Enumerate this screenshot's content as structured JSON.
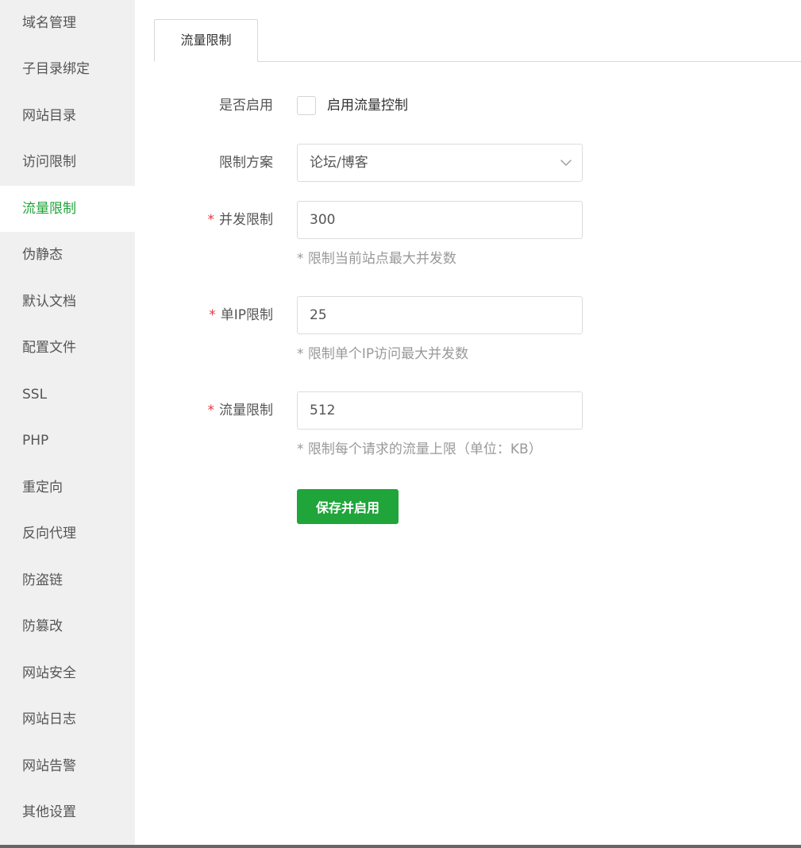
{
  "sidebar": {
    "items": [
      {
        "label": "域名管理"
      },
      {
        "label": "子目录绑定"
      },
      {
        "label": "网站目录"
      },
      {
        "label": "访问限制"
      },
      {
        "label": "流量限制",
        "active": true
      },
      {
        "label": "伪静态"
      },
      {
        "label": "默认文档"
      },
      {
        "label": "配置文件"
      },
      {
        "label": "SSL"
      },
      {
        "label": "PHP"
      },
      {
        "label": "重定向"
      },
      {
        "label": "反向代理"
      },
      {
        "label": "防盗链"
      },
      {
        "label": "防篡改"
      },
      {
        "label": "网站安全"
      },
      {
        "label": "网站日志"
      },
      {
        "label": "网站告警"
      },
      {
        "label": "其他设置"
      }
    ]
  },
  "tabs": [
    {
      "label": "流量限制",
      "active": true
    }
  ],
  "form": {
    "enable": {
      "label": "是否启用",
      "checkbox_label": "启用流量控制",
      "checked": false
    },
    "plan": {
      "label": "限制方案",
      "selected": "论坛/博客"
    },
    "concurrency": {
      "required_mark": "*",
      "label": "并发限制",
      "value": "300",
      "hint": "* 限制当前站点最大并发数"
    },
    "per_ip": {
      "required_mark": "*",
      "label": "单IP限制",
      "value": "25",
      "hint": "* 限制单个IP访问最大并发数"
    },
    "traffic": {
      "required_mark": "*",
      "label": "流量限制",
      "value": "512",
      "hint": "* 限制每个请求的流量上限（单位：KB）"
    },
    "save_label": "保存并启用"
  },
  "colors": {
    "accent": "#20a53a",
    "required": "#e0393e",
    "sidebar_bg": "#f0f0f0"
  }
}
